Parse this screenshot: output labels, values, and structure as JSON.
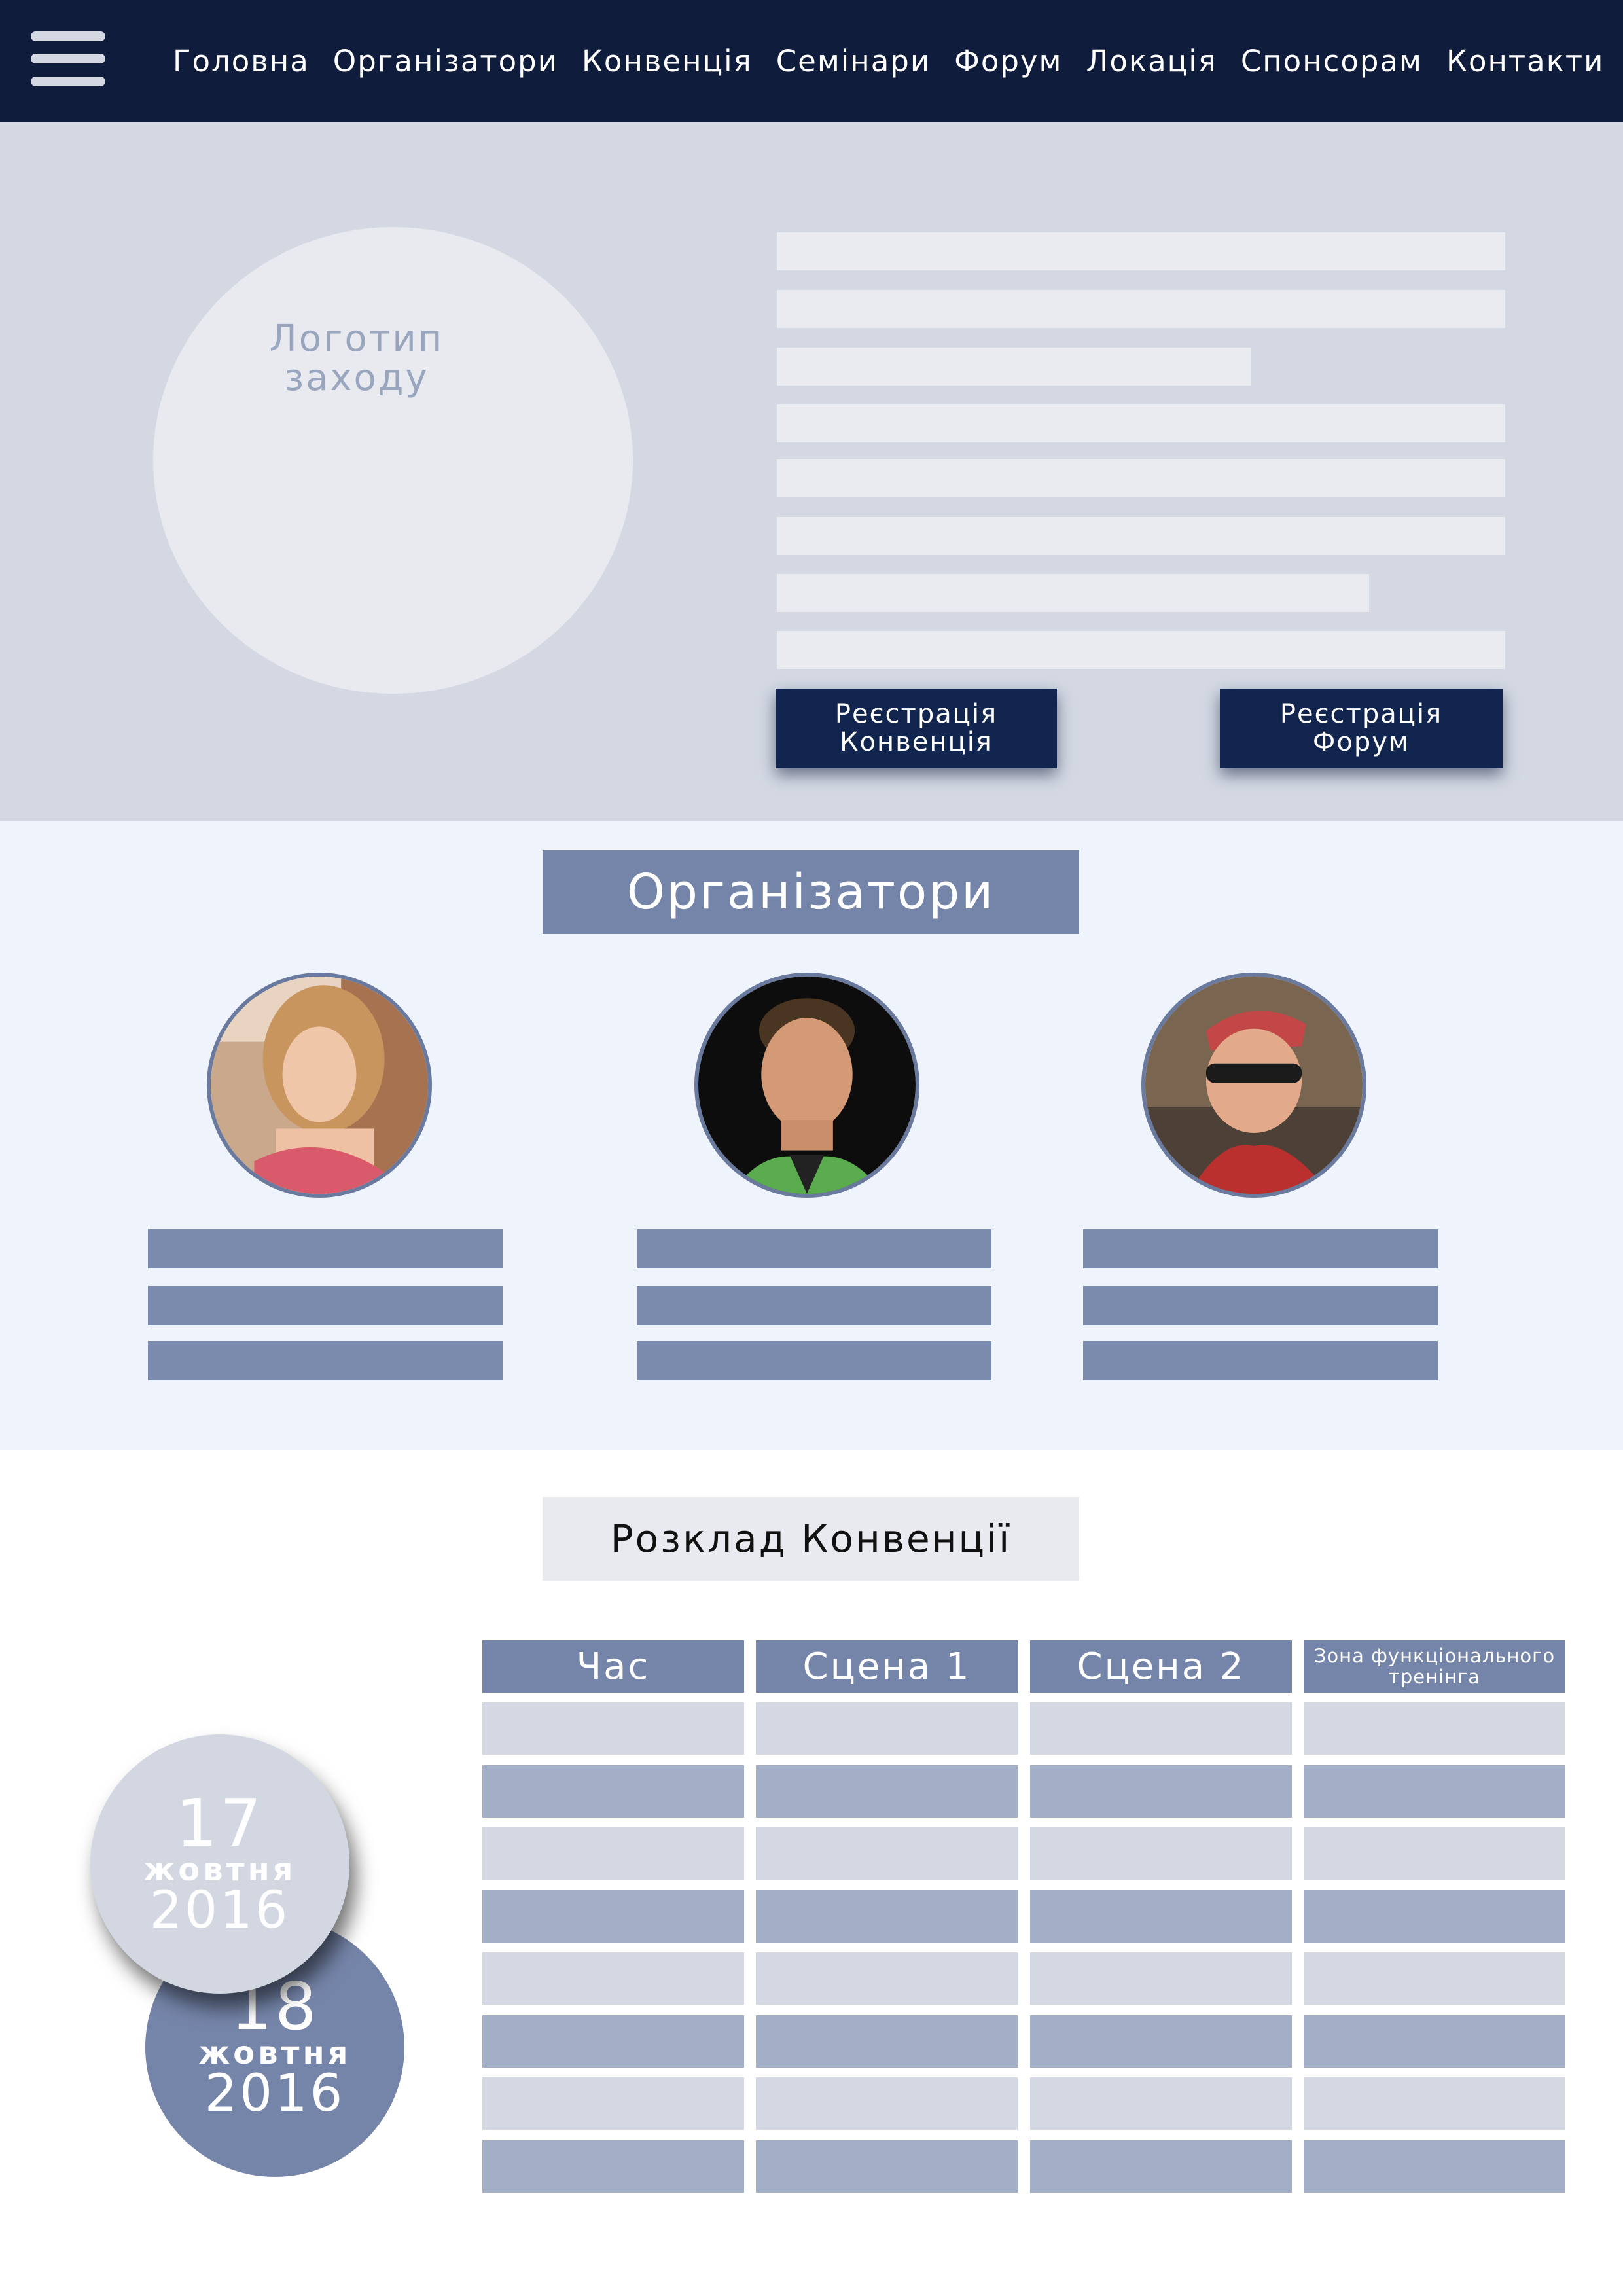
{
  "header": {
    "menu_icon": "hamburger-menu-icon",
    "nav": [
      "Головна",
      "Організатори",
      "Конвенція",
      "Семінари",
      "Форум",
      "Локація",
      "Спонсорам",
      "Контакти"
    ]
  },
  "hero": {
    "logo_placeholder": "Логотип\nзаходу",
    "register_convention": "Реєстрація\nКонвенція",
    "register_forum": "Реєстрація\nФорум"
  },
  "organizers": {
    "title": "Організатори",
    "people": [
      {
        "photo": "organizer-photo-woman"
      },
      {
        "photo": "organizer-photo-man"
      },
      {
        "photo": "organizer-photo-man-sunglasses"
      }
    ]
  },
  "schedule": {
    "title": "Розклад Конвенції",
    "columns": [
      "Час",
      "Сцена 1",
      "Сцена 2",
      "Зона функціонального тренінга"
    ],
    "dates": [
      {
        "day": "17",
        "month": "жовтня",
        "year": "2016"
      },
      {
        "day": "18",
        "month": "жовтня",
        "year": "2016"
      }
    ]
  },
  "colors": {
    "header_bg": "#101c3c",
    "hero_bg": "#d3d8e3",
    "accent": "#7585a9",
    "button_bg": "#12254f"
  }
}
